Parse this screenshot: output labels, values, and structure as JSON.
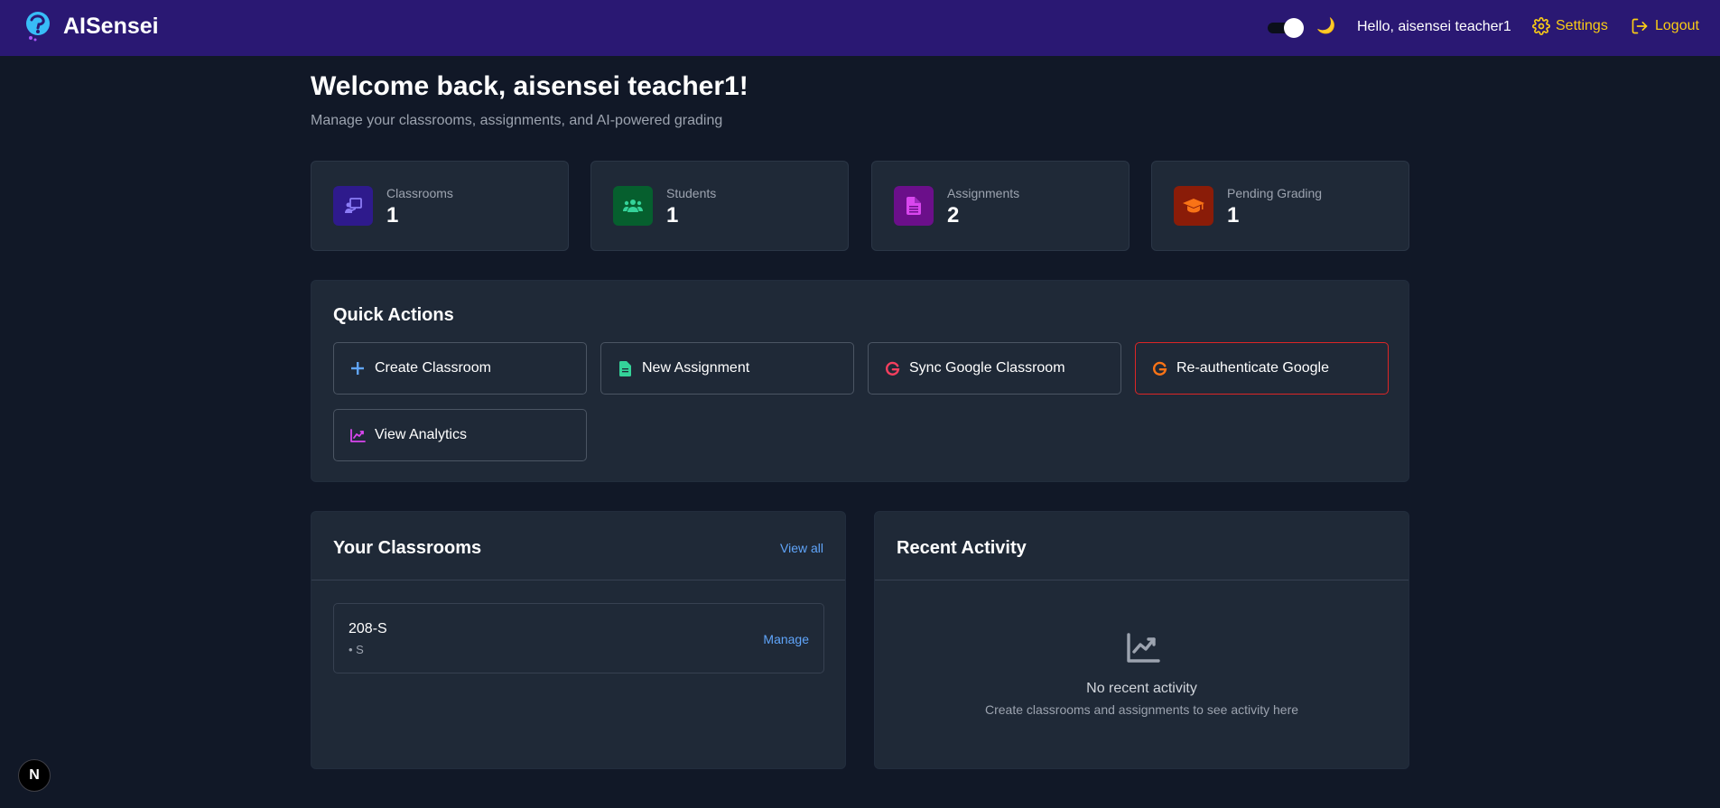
{
  "header": {
    "app_name": "AISensei",
    "greeting": "Hello, aisensei teacher1",
    "settings_label": "Settings",
    "logout_label": "Logout",
    "theme_toggle": "dark",
    "moon_glyph": "🌙"
  },
  "welcome": {
    "title": "Welcome back, aisensei teacher1!",
    "subtitle": "Manage your classrooms, assignments, and AI-powered grading"
  },
  "stats": [
    {
      "label": "Classrooms",
      "value": "1",
      "icon": "classroom-icon",
      "bg": "#2e1a8c",
      "fg": "#8b7cf6"
    },
    {
      "label": "Students",
      "value": "1",
      "icon": "students-icon",
      "bg": "#065f2e",
      "fg": "#34d399"
    },
    {
      "label": "Assignments",
      "value": "2",
      "icon": "document-icon",
      "bg": "#6b0f8a",
      "fg": "#d946ef"
    },
    {
      "label": "Pending Grading",
      "value": "1",
      "icon": "graduation-cap-icon",
      "bg": "#8a1c08",
      "fg": "#f97316"
    }
  ],
  "quick_actions": {
    "title": "Quick Actions",
    "items": [
      {
        "label": "Create Classroom",
        "icon": "plus-icon",
        "color": "#60a5fa"
      },
      {
        "label": "New Assignment",
        "icon": "file-icon",
        "color": "#34d399"
      },
      {
        "label": "Sync Google Classroom",
        "icon": "google-icon",
        "color": "#f43f5e"
      },
      {
        "label": "Re-authenticate Google",
        "icon": "google-icon",
        "color": "#f97316"
      },
      {
        "label": "View Analytics",
        "icon": "chart-line-icon",
        "color": "#d946ef"
      }
    ]
  },
  "classrooms": {
    "title": "Your Classrooms",
    "view_all": "View all",
    "items": [
      {
        "name": "208-S",
        "meta": "• S",
        "action": "Manage"
      }
    ]
  },
  "activity": {
    "title": "Recent Activity",
    "empty_title": "No recent activity",
    "empty_subtitle": "Create classrooms and assignments to see activity here"
  },
  "next_badge": "N"
}
